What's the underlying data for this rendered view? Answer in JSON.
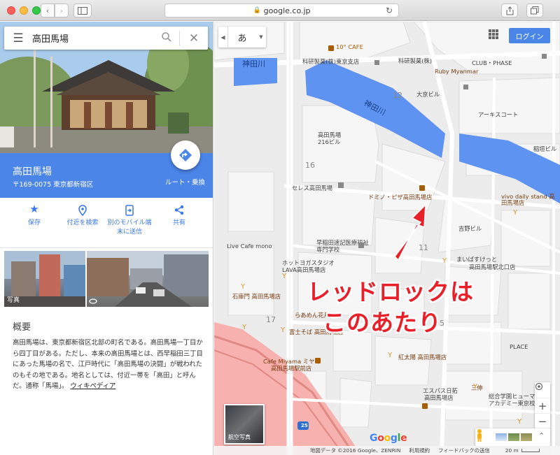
{
  "browser": {
    "url": "google.co.jp"
  },
  "search": {
    "query": "高田馬場"
  },
  "place": {
    "name": "高田馬場",
    "address": "〒169-0075 東京都新宿区",
    "route_label": "ルート・乗換"
  },
  "actions": [
    {
      "label": "保存",
      "icon": "star-icon"
    },
    {
      "label": "付近を検索",
      "icon": "location-pin-icon"
    },
    {
      "label": "別のモバイル端末に送信",
      "label_line1": "別のモバイル端",
      "label_line2": "末に送信",
      "icon": "send-to-device-icon"
    },
    {
      "label": "共有",
      "icon": "share-icon"
    }
  ],
  "photos": {
    "label": "写真"
  },
  "overview": {
    "title": "概要",
    "text": "高田馬場は、東京都新宿区北部の町名である。高田馬場一丁目から四丁目がある。ただし、本来の高田馬場とは、西早稲田三丁目にあった馬場の名で、江戸時代に「高田馬場の決闘」が戦われたのもその地である。地名としては、付近一帯を「高田」と呼んだ。通称「馬場」。",
    "link": "ウィキペディア"
  },
  "map": {
    "language_label": "あ",
    "login_label": "ログイン",
    "annotation_line1": "レッドロックは",
    "annotation_line2": "このあたり",
    "aerial_label": "航空写真",
    "google_logo": "Google",
    "route_shield": "25",
    "labels": {
      "cafe_10": "10° CAFE",
      "kaken1": "科研製薬(株)東京支店",
      "kaken2": "科研製薬(株)",
      "ruby": "Ruby Myanmar",
      "club": "CLUB・PHASE",
      "taikyo": "大京ビル",
      "arkis": "アーキスコート",
      "inaba": "稲垣ビル",
      "takada216": "高田馬場216ビル",
      "seres": "セレス高田馬場",
      "domino": "ドミノ・ピザ高田馬場店",
      "vivo": "vivo daily stand 高田馬場店",
      "yoshino": "吉野ビル",
      "livecafe": "Live Cafe mono",
      "waseda": "早稲田速記医療福祉専門学校",
      "hotyoga1": "ホットヨガスタジオ",
      "hotyoga2": "LAVA高田馬場店",
      "ishiya": "石庫門 高田馬場店",
      "raamen": "らあめん花月",
      "fuji": "富士そば 高田馬場店",
      "cafemiyama1": "Cafe Miyama ミヤマ",
      "cafemiyama2": "高田馬場駅前店",
      "beniwo": "紅太陽 高田馬場店",
      "mybasket1": "まいばすけっと",
      "mybasket2": "高田馬場駅北口店",
      "place": "PLACE",
      "espas1": "エスパス日拓",
      "espas2": "高田馬場店",
      "sanshin": "三伸",
      "sogo1": "総合学園ヒューマン",
      "sogo2": "アカデミー東京校",
      "river1": "神田川",
      "river2": "神田川",
      "n12": "12",
      "n16": "16",
      "n11": "11",
      "n17": "17",
      "n5": "5"
    }
  },
  "footer": {
    "map_data": "地図データ ©2016 Google、ZENRIN",
    "terms": "利用規約",
    "feedback": "フィードバックの送信",
    "scale": "20 m"
  },
  "colors": {
    "accent": "#4b85e8",
    "river": "#5f93f1",
    "station_area": "#f7b1ae",
    "annotation": "#e8202a"
  }
}
